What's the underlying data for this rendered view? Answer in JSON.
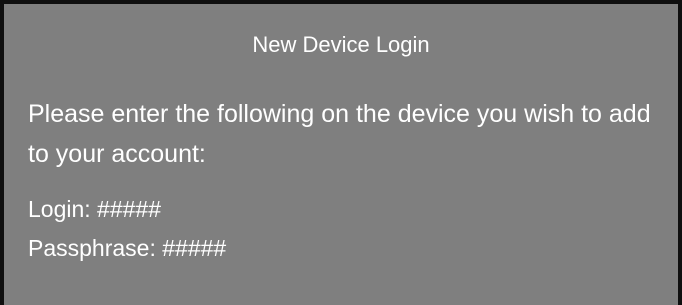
{
  "dialog": {
    "title": "New Device Login",
    "message": "Please enter the following on the device you wish to add to your account:",
    "login_line": "Login: #####",
    "passphrase_line": "Passphrase: #####"
  },
  "colors": {
    "background": "#7f7f7f",
    "border": "#0f0f0f",
    "text": "#ffffff"
  }
}
